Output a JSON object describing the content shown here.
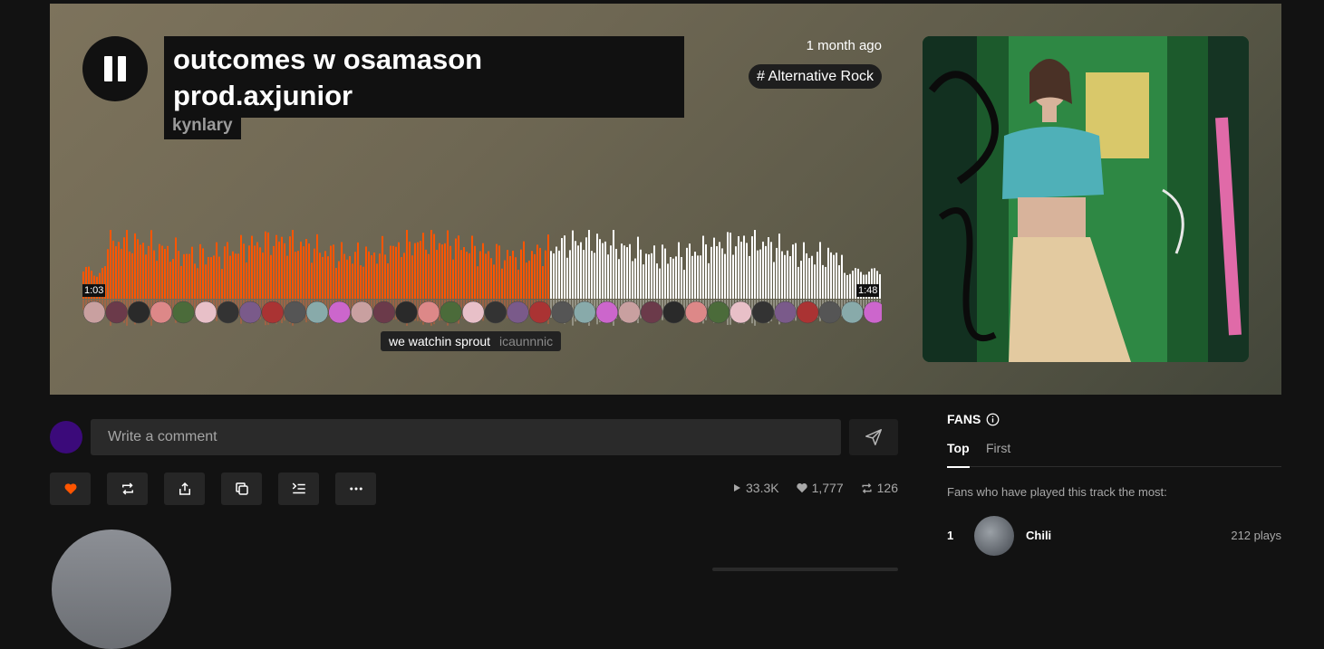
{
  "track": {
    "title_line1": "outcomes w osamason",
    "title_line2": "prod.axjunior",
    "artist": "kynlary",
    "posted": "1 month ago",
    "genre": "# Alternative Rock"
  },
  "player": {
    "state": "playing",
    "current_time": "1:03",
    "duration": "1:48",
    "progress": 0.583,
    "played_color": "#ff5500",
    "unplayed_color": "#ffffff"
  },
  "timed_comment": {
    "text": "we watchin sprout",
    "user": "icaunnnic"
  },
  "comment_box": {
    "placeholder": "Write a comment"
  },
  "actions": {
    "like_icon": "heart-icon",
    "repost_icon": "repost-icon",
    "share_icon": "share-icon",
    "copy_icon": "copy-link-icon",
    "queue_icon": "add-to-queue-icon",
    "more_icon": "more-icon",
    "like_active_color": "#ff5500"
  },
  "stats": {
    "plays": "33.3K",
    "likes": "1,777",
    "reposts": "126"
  },
  "fans": {
    "title": "FANS",
    "tabs": [
      "Top",
      "First"
    ],
    "active_tab": "Top",
    "description": "Fans who have played this track the most:",
    "list": [
      {
        "rank": "1",
        "name": "Chili",
        "plays": "212 plays"
      }
    ]
  }
}
